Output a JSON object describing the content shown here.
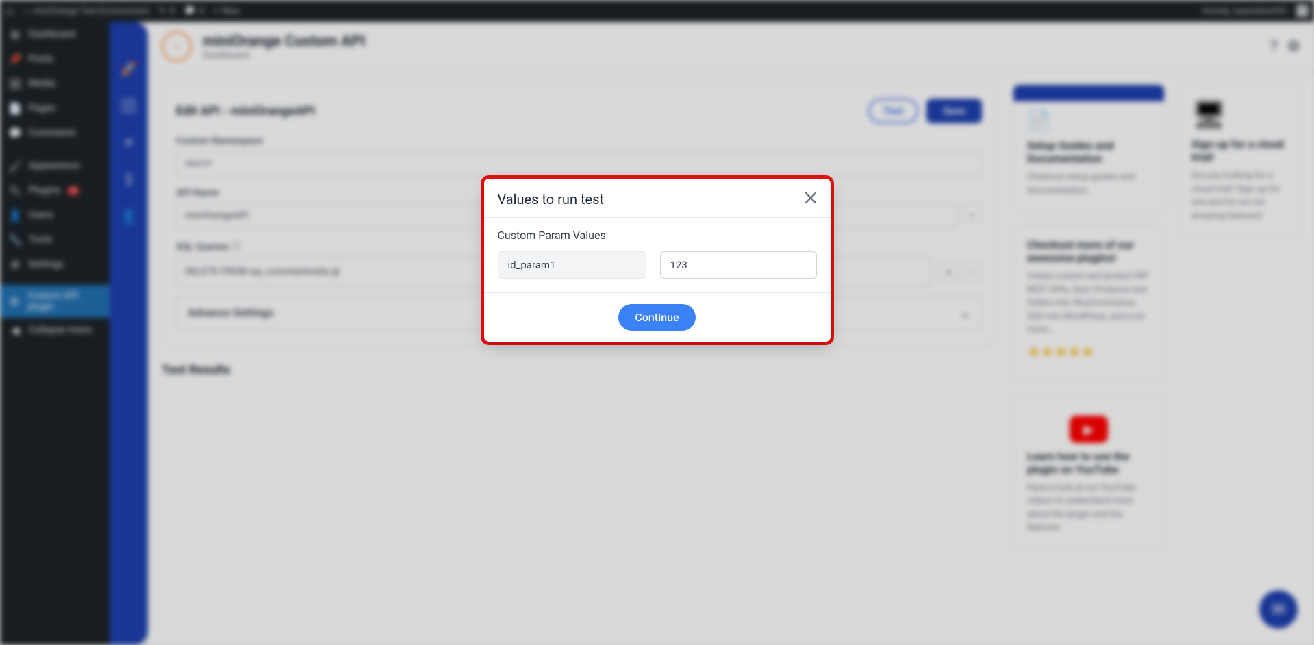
{
  "adminbar": {
    "site": "miniOrange Test Environment",
    "updates_count": "8",
    "comments_count": "0",
    "new": "New",
    "howdy": "Howdy, rayeesbhat55"
  },
  "wp_menu": {
    "dashboard": "Dashboard",
    "posts": "Posts",
    "media": "Media",
    "pages": "Pages",
    "comments": "Comments",
    "appearance": "Appearance",
    "plugins": "Plugins",
    "plugins_badge": "5",
    "users": "Users",
    "tools": "Tools",
    "settings": "Settings",
    "custom_api": "Custom API plugin",
    "collapse": "Collapse menu"
  },
  "header": {
    "title": "miniOrange Custom API",
    "sub": "Dashboard"
  },
  "main": {
    "edit_title": "Edit API - miniOrangeAPI",
    "test_btn": "Test",
    "save_btn": "Save",
    "namespace_label": "Custom Namespace",
    "namespace_value": "mo/v1",
    "apiname_label": "API Name",
    "apiname_value": "miniOrangeAPI",
    "sql_label": "SQL Queries",
    "sql_value": "DELETE FROM wp_commentmeta @",
    "advance": "Advance Settings",
    "test_results": "Test Results"
  },
  "promo": {
    "guides_title": "Setup Guides and Documentation",
    "guides_text": "Checkout setup guides and documentation.",
    "cloud_title": "Sign up for a cloud trial!",
    "cloud_text": "Are you looking for a cloud trial? Sign up for one and try out our amazing features!",
    "plugins_title": "Checkout more of our awesome plugins!",
    "plugins_text": "Create custom and protect WP REST APIs, Sync Products and Orders into WooCommerce, SSO into WordPress, and a lot more...",
    "youtube_title": "Learn how to use the plugin on YouTube",
    "youtube_text": "Have a look at our YouTube videos to understand more about the plugin and the features."
  },
  "modal": {
    "title": "Values to run test",
    "section": "Custom Param Values",
    "param_name": "id_param1",
    "param_value": "123",
    "continue": "Continue"
  }
}
